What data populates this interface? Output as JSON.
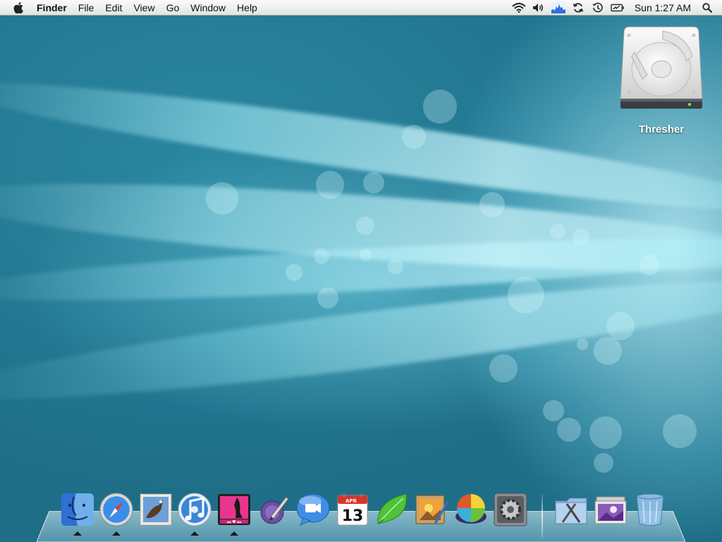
{
  "menubar": {
    "apple_icon": "apple-logo-icon",
    "items": [
      {
        "label": "Finder",
        "bold": true
      },
      {
        "label": "File"
      },
      {
        "label": "Edit"
      },
      {
        "label": "View"
      },
      {
        "label": "Go"
      },
      {
        "label": "Window"
      },
      {
        "label": "Help"
      }
    ],
    "status_icons": [
      "wifi-icon",
      "volume-icon",
      "activity-graph-icon",
      "sync-icon",
      "time-machine-icon",
      "battery-charging-icon"
    ],
    "clock": "Sun 1:27 AM",
    "spotlight_icon": "spotlight-search-icon"
  },
  "desktop": {
    "drive": {
      "label": "Thresher",
      "icon": "hard-drive-icon"
    }
  },
  "dock": {
    "apps": [
      {
        "icon": "finder-icon",
        "running": true
      },
      {
        "icon": "safari-icon",
        "running": true
      },
      {
        "icon": "mail-icon",
        "running": false
      },
      {
        "icon": "itunes-icon",
        "running": true
      },
      {
        "icon": "coverflow-player-icon",
        "running": true
      },
      {
        "icon": "script-editor-icon",
        "running": false
      },
      {
        "icon": "ichat-icon",
        "running": false
      },
      {
        "icon": "ical-icon",
        "running": false,
        "month": "APR",
        "day": "13"
      },
      {
        "icon": "leaf-app-icon",
        "running": false
      },
      {
        "icon": "preview-icon",
        "running": false
      },
      {
        "icon": "istat-icon",
        "running": false
      },
      {
        "icon": "system-preferences-icon",
        "running": false
      }
    ],
    "stacks": [
      {
        "icon": "applications-stack-icon"
      },
      {
        "icon": "documents-stack-icon"
      },
      {
        "icon": "trash-icon"
      }
    ]
  },
  "colors": {
    "wallpaper_base": "#1f6e88",
    "wallpaper_light": "#bef0fa",
    "menubar_text": "#111111"
  }
}
